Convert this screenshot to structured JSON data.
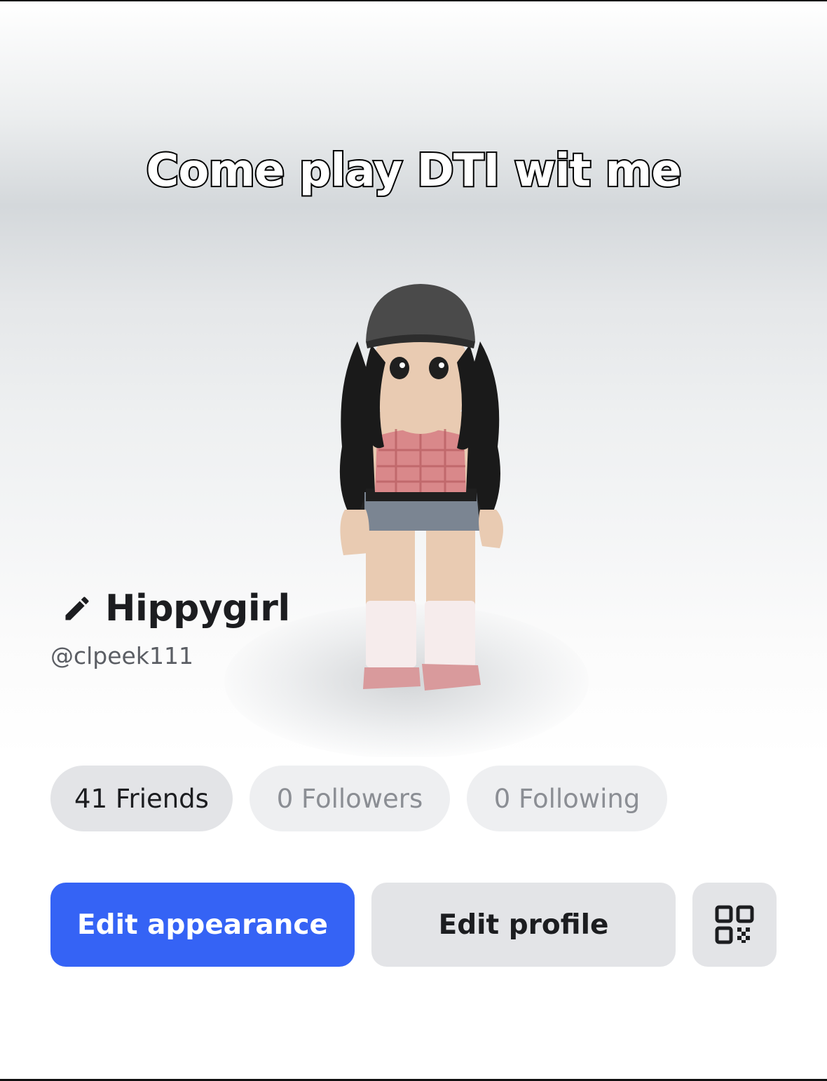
{
  "hero": {
    "caption": "Come play DTI wit me",
    "avatar_icon": "avatar-character"
  },
  "profile": {
    "display_name": "Hippygirl",
    "username": "@clpeek111",
    "edit_icon": "pencil-icon"
  },
  "stats": {
    "friends": "41 Friends",
    "followers": "0 Followers",
    "following": "0 Following"
  },
  "actions": {
    "edit_appearance": "Edit appearance",
    "edit_profile": "Edit profile",
    "qr_icon": "qr-code-icon"
  },
  "colors": {
    "primary": "#3563f5",
    "pill_active": "#e3e4e7",
    "pill_inactive": "#eeeff1",
    "text_dark": "#1c1d20",
    "text_muted": "#8b8e94"
  }
}
